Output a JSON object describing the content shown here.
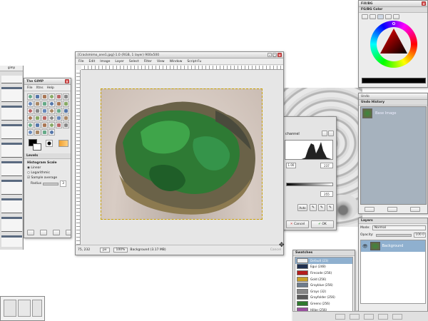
{
  "colors": {
    "accent": "#8fb0cf",
    "canvas_bg": "#e6e6e6",
    "history_bg": "#a6b2be",
    "ok": "#3a9a3a"
  },
  "left_strip": {
    "title": "gimp"
  },
  "toolbox": {
    "title": "The GIMP",
    "menu": [
      "File",
      "Xtns",
      "Help"
    ],
    "tools": [
      "rect-select",
      "ellipse-select",
      "free-select",
      "fuzzy-select",
      "by-color-select",
      "scissors",
      "paths",
      "color-picker",
      "zoom",
      "measure",
      "move",
      "align",
      "crop",
      "rotate",
      "scale",
      "shear",
      "perspective",
      "flip",
      "text",
      "bucket-fill",
      "blend",
      "pencil",
      "paintbrush",
      "eraser",
      "airbrush",
      "ink",
      "clone",
      "heal",
      "perspective-clone",
      "blur",
      "smudge",
      "dodge",
      "foreground-select",
      "magnify"
    ],
    "options": {
      "header": "Levels",
      "scale_label": "Histogram Scale",
      "linear": "Linear",
      "log": "Logarithmic",
      "sample": "Sample average",
      "radius_label": "Radius",
      "radius_value": "3"
    }
  },
  "image_window": {
    "title": "[Crackmimo_one1.jpg]-1.0 (RGB, 1 layer) 900x500",
    "menu": [
      "File",
      "Edit",
      "Image",
      "Layer",
      "Select",
      "Filter",
      "View",
      "Window",
      "Script-Fu"
    ],
    "status": {
      "coords": "75, 232",
      "unit": "px",
      "zoom": "100%",
      "info": "Background (3.17 MB)",
      "cancel": "Cancel"
    }
  },
  "levels": {
    "channel_label": "channel",
    "gamma": "1.00",
    "right_value": "237",
    "out_value": "255",
    "auto": "Auto",
    "cancel": "Cancel",
    "ok": "OK"
  },
  "fgbg": {
    "title": "FG/BG Color",
    "window_title": "Fill/BG"
  },
  "undo": {
    "header": "Undo History",
    "item": "Base Image"
  },
  "layers": {
    "header": "Layers",
    "mode_label": "Mode:",
    "mode": "Normal",
    "opacity_label": "Opacity:",
    "opacity": "100.0",
    "layer_name": "Background"
  },
  "swatches": {
    "title": "Swatches",
    "items": [
      {
        "name": "Default (23)",
        "color": "#f0f0f0"
      },
      {
        "name": "Egui (248)",
        "color": "#203050"
      },
      {
        "name": "Firecode (256)",
        "color": "#b41e1e"
      },
      {
        "name": "Gold (256)",
        "color": "#c8a02a"
      },
      {
        "name": "Grayblue (256)",
        "color": "#6e7c8c"
      },
      {
        "name": "Grays (32)",
        "color": "#888888"
      },
      {
        "name": "Grayfolder (256)",
        "color": "#5a5a5a"
      },
      {
        "name": "Greens (256)",
        "color": "#2e7a2e"
      },
      {
        "name": "Hilbe (256)",
        "color": "#9a4fa0"
      }
    ]
  }
}
